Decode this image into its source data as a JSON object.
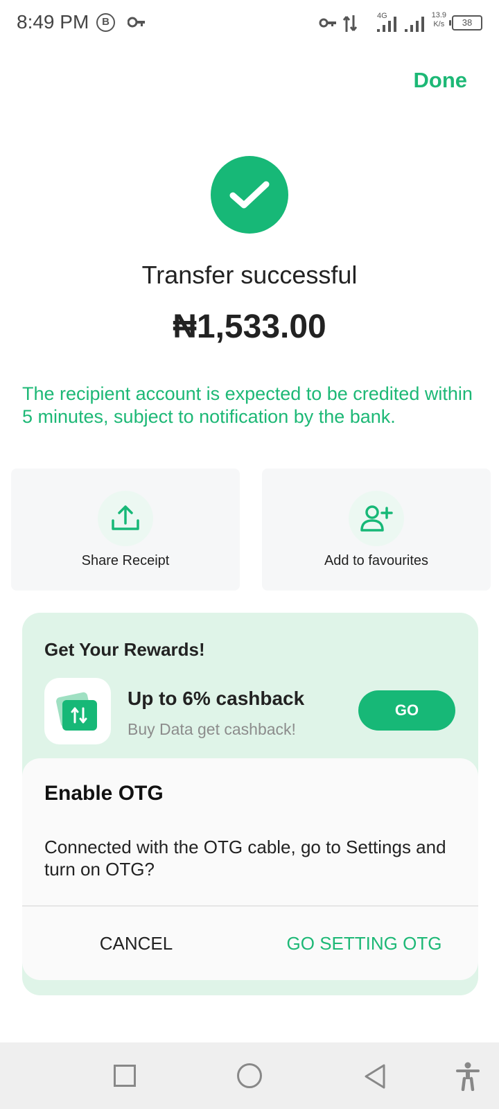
{
  "status_bar": {
    "time": "8:49 PM",
    "b_badge": "B",
    "network": "4G",
    "speed_value": "13.9",
    "speed_unit": "K/s",
    "battery": "38",
    "icons": [
      "b-circle-icon",
      "key-icon",
      "vpn-key-icon",
      "data-transfer-icon",
      "signal-icon",
      "signal-icon",
      "battery-icon"
    ]
  },
  "header": {
    "done_label": "Done"
  },
  "result": {
    "status_icon": "check-circle-icon",
    "title": "Transfer successful",
    "amount": "₦1,533.00",
    "notice": "The recipient account is expected to be credited within 5 minutes, subject to notification by the bank."
  },
  "actions": [
    {
      "label": "Share Receipt",
      "icon": "upload-share-icon"
    },
    {
      "label": "Add to favourites",
      "icon": "add-user-icon"
    }
  ],
  "rewards": {
    "title": "Get Your Rewards!",
    "headline": "Up to 6% cashback",
    "subtitle": "Buy Data get cashback!",
    "button_label": "GO",
    "icon": "data-transfer-card-icon"
  },
  "dialog": {
    "title": "Enable OTG",
    "message": "Connected with the OTG cable, go to Settings and turn on OTG?",
    "cancel_label": "CANCEL",
    "confirm_label": "GO SETTING OTG"
  },
  "nav_bar": {
    "icons": [
      "recent-apps-icon",
      "home-icon",
      "back-icon",
      "accessibility-icon"
    ]
  },
  "colors": {
    "accent": "#17b877",
    "accent_text": "#1db876",
    "rewards_bg": "#dff4e8",
    "card_bg": "#f6f7f8"
  }
}
